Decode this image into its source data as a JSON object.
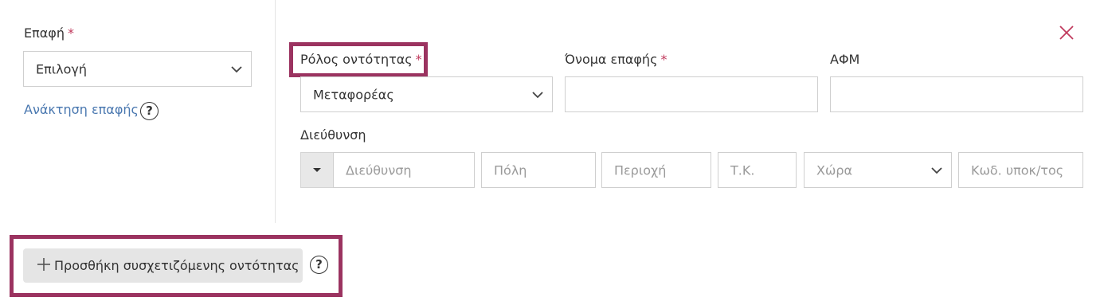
{
  "left": {
    "contact_label": "Επαφή",
    "required_mark": "*",
    "contact_select_placeholder": "Επιλογή",
    "retrieve_link": "Ανάκτηση επαφής",
    "help_symbol": "?"
  },
  "form": {
    "role_label": "Ρόλος οντότητας",
    "role_value": "Μεταφορέας",
    "contact_name_label": "Όνομα επαφής",
    "contact_name_value": "",
    "tax_id_label": "ΑΦΜ",
    "tax_id_value": "",
    "address_label": "Διεύθυνση",
    "address": {
      "street_placeholder": "Διεύθυνση",
      "city_placeholder": "Πόλη",
      "region_placeholder": "Περιοχή",
      "zip_placeholder": "Τ.Κ.",
      "country_placeholder": "Χώρα",
      "store_code_placeholder": "Κωδ. υποκ/τος"
    }
  },
  "footer": {
    "add_related_entity_label": "Προσθήκη συσχετιζόμενης οντότητας",
    "help_symbol": "?"
  },
  "colors": {
    "accent_required": "#c0395c",
    "link": "#4a78b0",
    "highlight_border": "#9b3360",
    "close_icon": "#c0395c"
  },
  "icons": {
    "close": "close-icon",
    "chevron": "chevron-down-icon",
    "help": "question-circle-icon",
    "plus": "plus-icon",
    "dropdown_triangle": "caret-down-icon"
  }
}
